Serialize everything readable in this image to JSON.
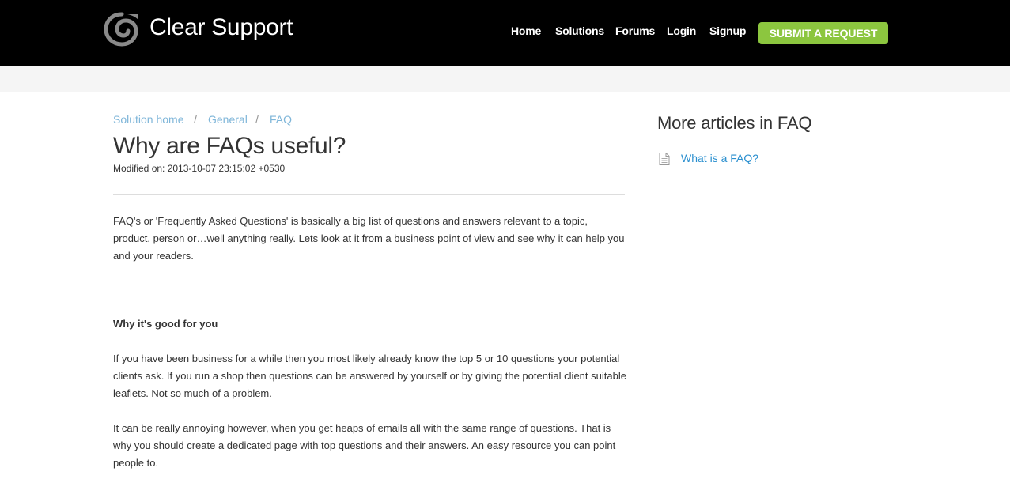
{
  "header": {
    "brand": "Clear Support",
    "nav": {
      "home": "Home",
      "solutions": "Solutions",
      "forums": "Forums",
      "login": "Login",
      "signup": "Signup"
    },
    "submit_request": "SUBMIT A REQUEST",
    "logo_icon": "swirl-logo-icon"
  },
  "breadcrumb": {
    "items": [
      "Solution home",
      "General",
      "FAQ"
    ],
    "separator": "/"
  },
  "article": {
    "title": "Why are FAQs useful?",
    "modified": "Modified on: 2013-10-07 23:15:02 +0530",
    "paragraph1": "FAQ's or 'Frequently Asked Questions' is basically a big list of questions and answers relevant to a topic, product, person or…well anything really. Lets look at it from a business point of view and see why it can help you and your readers.",
    "heading1": "Why it's good for you",
    "paragraph2": "If you have been business for a while then you most likely already know the top 5 or 10 questions your potential clients ask. If you run a shop then questions can be answered by yourself or by giving the potential client suitable leaflets. Not so much of a problem.",
    "paragraph3": "It can be really annoying however, when you get heaps of emails all with the same range of questions. That is why you should create a dedicated page with top questions and their answers. An easy resource you can point people to."
  },
  "sidebar": {
    "title": "More articles in FAQ",
    "articles": [
      {
        "label": "What is a FAQ?",
        "icon": "document-icon"
      }
    ]
  },
  "colors": {
    "header_bg": "#000000",
    "accent_button": "#8cc63f",
    "link": "#2a8fcf",
    "breadcrumb_link": "#7fb6d9",
    "subbar_bg": "#f5f5f5"
  }
}
